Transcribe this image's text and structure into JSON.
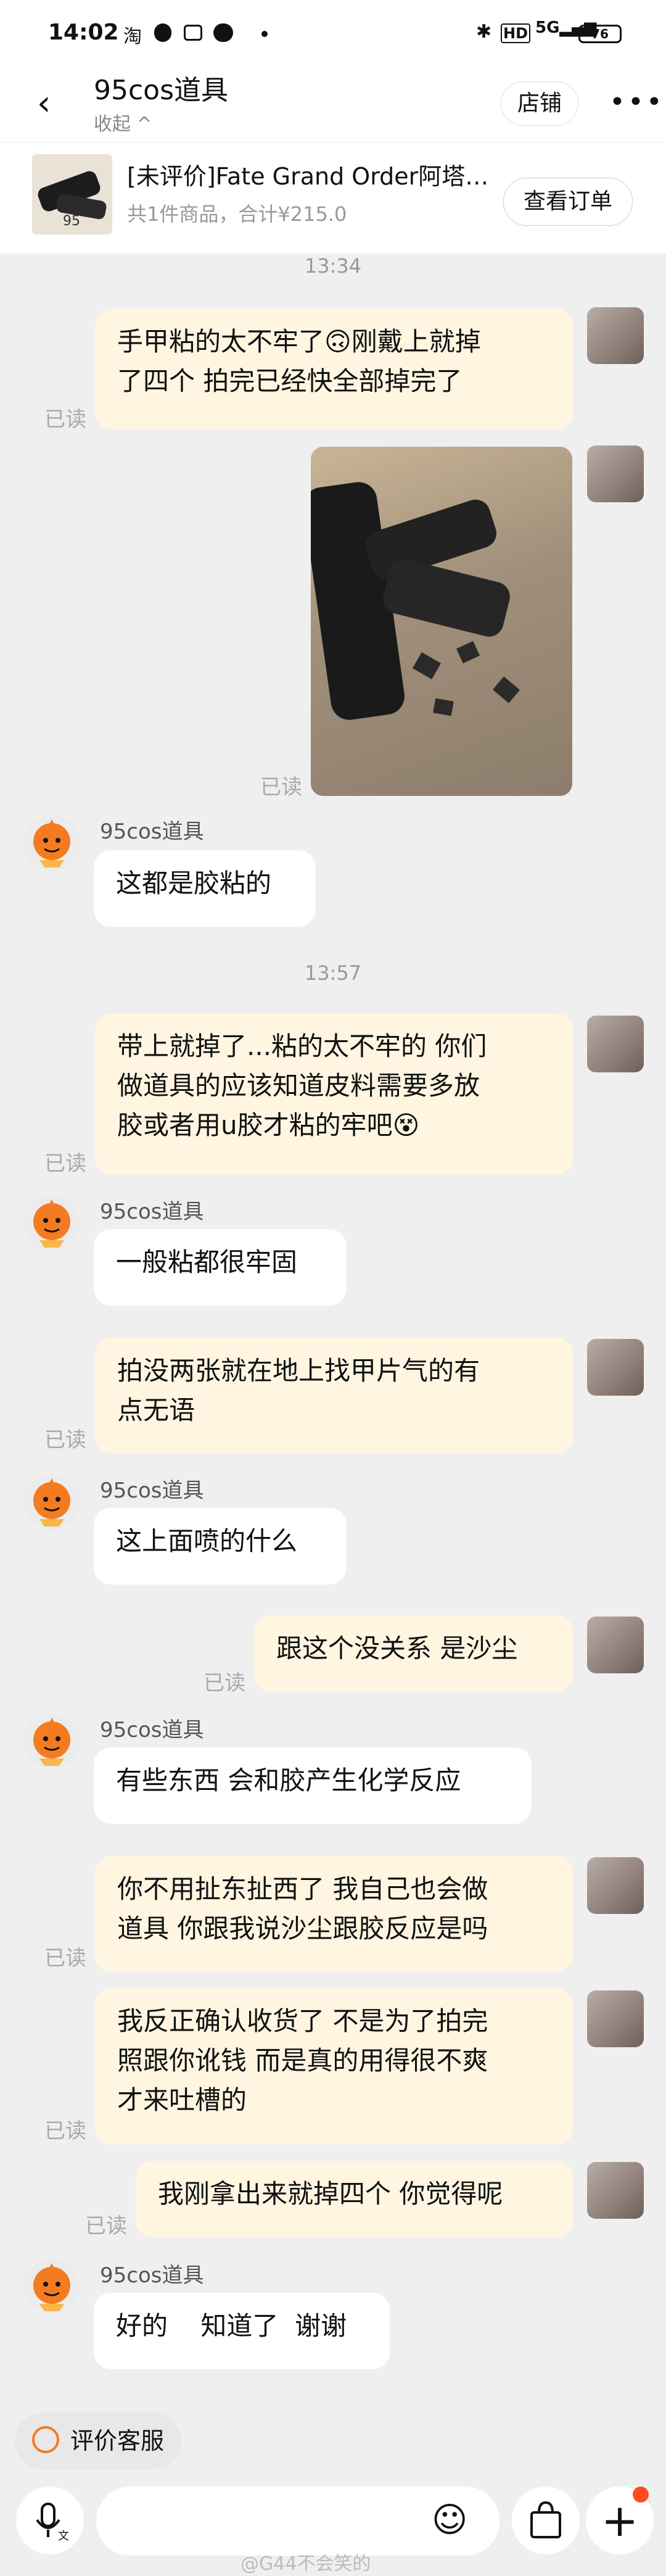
{
  "status_bar": {
    "time": "14:02",
    "left_icons": [
      "taobao-icon",
      "qq-icon",
      "bilibili-icon",
      "weibo-icon",
      "dot-icon"
    ],
    "right_text": "HD  5G",
    "battery": "76"
  },
  "header": {
    "shop_name": "95cos道具",
    "collapse_label": "收起 ^",
    "store_button": "店铺",
    "more": "•••"
  },
  "product": {
    "title": "[未评价]Fate Grand Order阿塔兰…",
    "subtitle": "共1件商品，合计¥215.0",
    "order_button": "查看订单",
    "image_label": "95"
  },
  "chat": {
    "ts1": "13:34",
    "ts2": "13:57",
    "read_label": "已读",
    "seller_name": "95cos道具",
    "m1": "手甲粘的太不牢了🙃刚戴上就掉\n了四个 拍完已经快全部掉完了",
    "m2": "这都是胶粘的",
    "m3": "带上就掉了...粘的太不牢的 你们\n做道具的应该知道皮料需要多放\n胶或者用u胶才粘的牢吧😵",
    "m4": "一般粘都很牢固",
    "m5": "拍没两张就在地上找甲片气的有\n点无语",
    "m6": "这上面喷的什么",
    "m7": "跟这个没关系 是沙尘",
    "m8": "有些东西 会和胶产生化学反应",
    "m9": "你不用扯东扯西了 我自己也会做\n道具 你跟我说沙尘跟胶反应是吗",
    "m10": "我反正确认收货了 不是为了拍完\n照跟你讹钱 而是真的用得很不爽\n才来吐槽的",
    "m11": "我刚拿出来就掉四个 你觉得呢",
    "m12": "好的    知道了  谢谢"
  },
  "bottom": {
    "rate_label": "评价客服",
    "watermark": "@G44不会笑的"
  },
  "colors": {
    "my_bubble": "#fff5e1",
    "their_bubble": "#ffffff",
    "background": "#efefef",
    "seller_avatar": "#f47b20",
    "notification_dot": "#ff4d1f"
  }
}
